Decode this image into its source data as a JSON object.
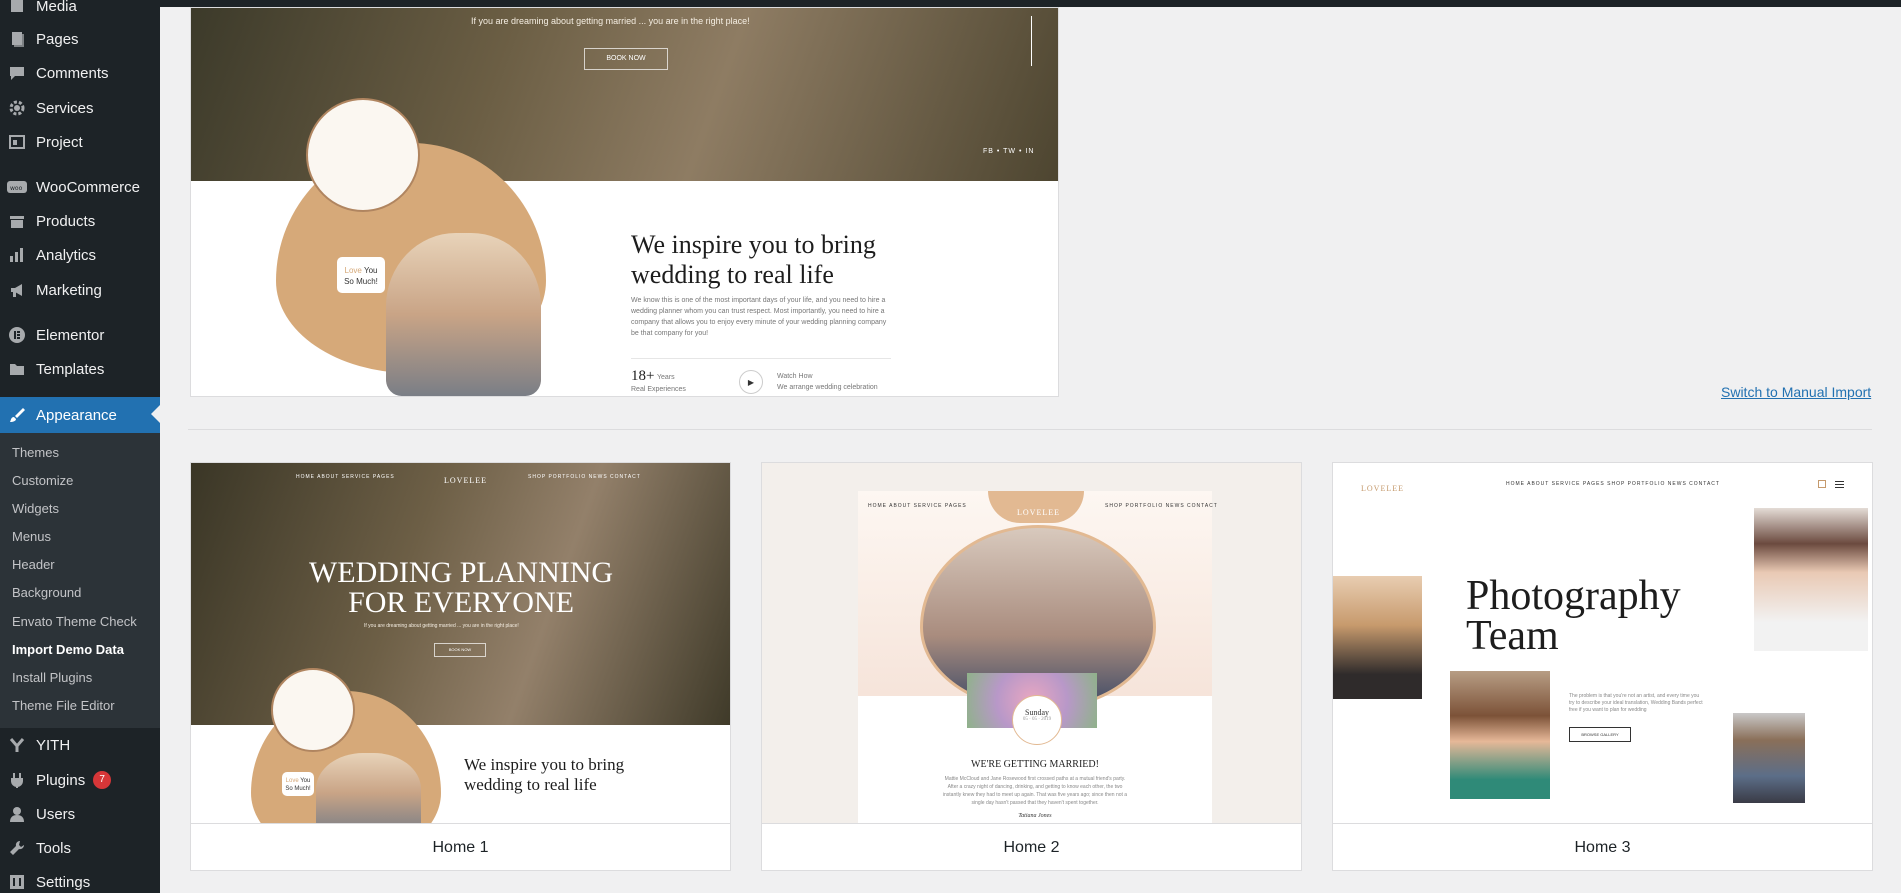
{
  "sidebar": {
    "items": [
      {
        "label": "Media",
        "icon": "media-icon"
      },
      {
        "label": "Pages",
        "icon": "pages-icon"
      },
      {
        "label": "Comments",
        "icon": "comments-icon"
      },
      {
        "label": "Services",
        "icon": "gear-icon"
      },
      {
        "label": "Project",
        "icon": "portfolio-icon"
      },
      {
        "label": "WooCommerce",
        "icon": "woo-icon"
      },
      {
        "label": "Products",
        "icon": "products-icon"
      },
      {
        "label": "Analytics",
        "icon": "analytics-icon"
      },
      {
        "label": "Marketing",
        "icon": "megaphone-icon"
      },
      {
        "label": "Elementor",
        "icon": "elementor-icon"
      },
      {
        "label": "Templates",
        "icon": "folder-icon"
      },
      {
        "label": "Appearance",
        "icon": "paintbrush-icon"
      },
      {
        "label": "YITH",
        "icon": "yith-icon"
      },
      {
        "label": "Plugins",
        "icon": "plug-icon",
        "badge": "7"
      },
      {
        "label": "Users",
        "icon": "users-icon"
      },
      {
        "label": "Tools",
        "icon": "wrench-icon"
      },
      {
        "label": "Settings",
        "icon": "settings-icon"
      }
    ],
    "appearance_submenu": [
      "Themes",
      "Customize",
      "Widgets",
      "Menus",
      "Header",
      "Background",
      "Envato Theme Check",
      "Import Demo Data",
      "Install Plugins",
      "Theme File Editor"
    ]
  },
  "preview": {
    "dream_text": "If you are dreaming about getting married ... you are in the right place!",
    "book_now": "BOOK NOW",
    "social": "FB  •  TW  •  IN",
    "love_badge_accent": "Love",
    "love_badge_you": " You",
    "love_badge_line2": "So Much!",
    "inspire_line1": "We inspire you to bring",
    "inspire_line2": "wedding to real life",
    "paragraph": "We know this is one of the most important days of your life, and you need to hire a wedding planner whom you can trust respect. Most importantly, you need to hire a company that allows you to enjoy every minute of your wedding planning company be that company for you!",
    "stat_number": "18+",
    "stat_unit": "Years",
    "stat_label": "Real Experiences",
    "watch_title": "Watch How",
    "watch_sub": "We arrange wedding celebration"
  },
  "switch_link": "Switch to Manual Import",
  "demos": [
    {
      "label": "Home 1",
      "nav": "HOME   ABOUT   SERVICE   PAGES",
      "nav_right": "SHOP   PORTFOLIO   NEWS   CONTACT",
      "logo": "LOVELEE",
      "headline_1": "WEDDING PLANNING",
      "headline_2": "FOR EVERYONE",
      "dream_text": "If you are dreaming about getting married ... you are in the right place!",
      "book_now": "BOOK NOW",
      "inspire_line1": "We inspire you to bring",
      "inspire_line2": "wedding to real life",
      "love_badge_accent": "Love",
      "love_badge_you": " You",
      "love_badge_line2": "So Much!"
    },
    {
      "label": "Home 2",
      "nav": "HOME   ABOUT   SERVICE   PAGES",
      "nav_right": "SHOP   PORTFOLIO   NEWS   CONTACT",
      "logo": "LOVELEE",
      "date_day": "Sunday",
      "date_num": "05 · 05 · 2019",
      "married": "WE'RE GETTING MARRIED!",
      "married_text": "Mattie McCloud and Jane Rosewood first crossed paths at a mutual friend's party. After a crazy night of dancing, drinking, and getting to know each other, the two instantly knew they had to meet up again. That was five years ago; since then not a single day hasn't passed that they haven't spent together.",
      "signature": "Tatiana Jones"
    },
    {
      "label": "Home 3",
      "logo": "LOVELEE",
      "nav": "HOME   ABOUT   SERVICE   PAGES   SHOP   PORTFOLIO   NEWS   CONTACT",
      "title_1": "Photography",
      "title_2": "Team",
      "body": "The problem is that you're not an artist, and every time you try to describe your ideal translation, Wedding Bands perfect free if you want to plan for wedding",
      "button": "BROWSE GALLERY"
    }
  ],
  "colors": {
    "admin_dark": "#1d2327",
    "submenu_bg": "#2c3338",
    "accent_blue": "#2271b1",
    "badge_red": "#d63638",
    "tan": "#d6a979"
  }
}
